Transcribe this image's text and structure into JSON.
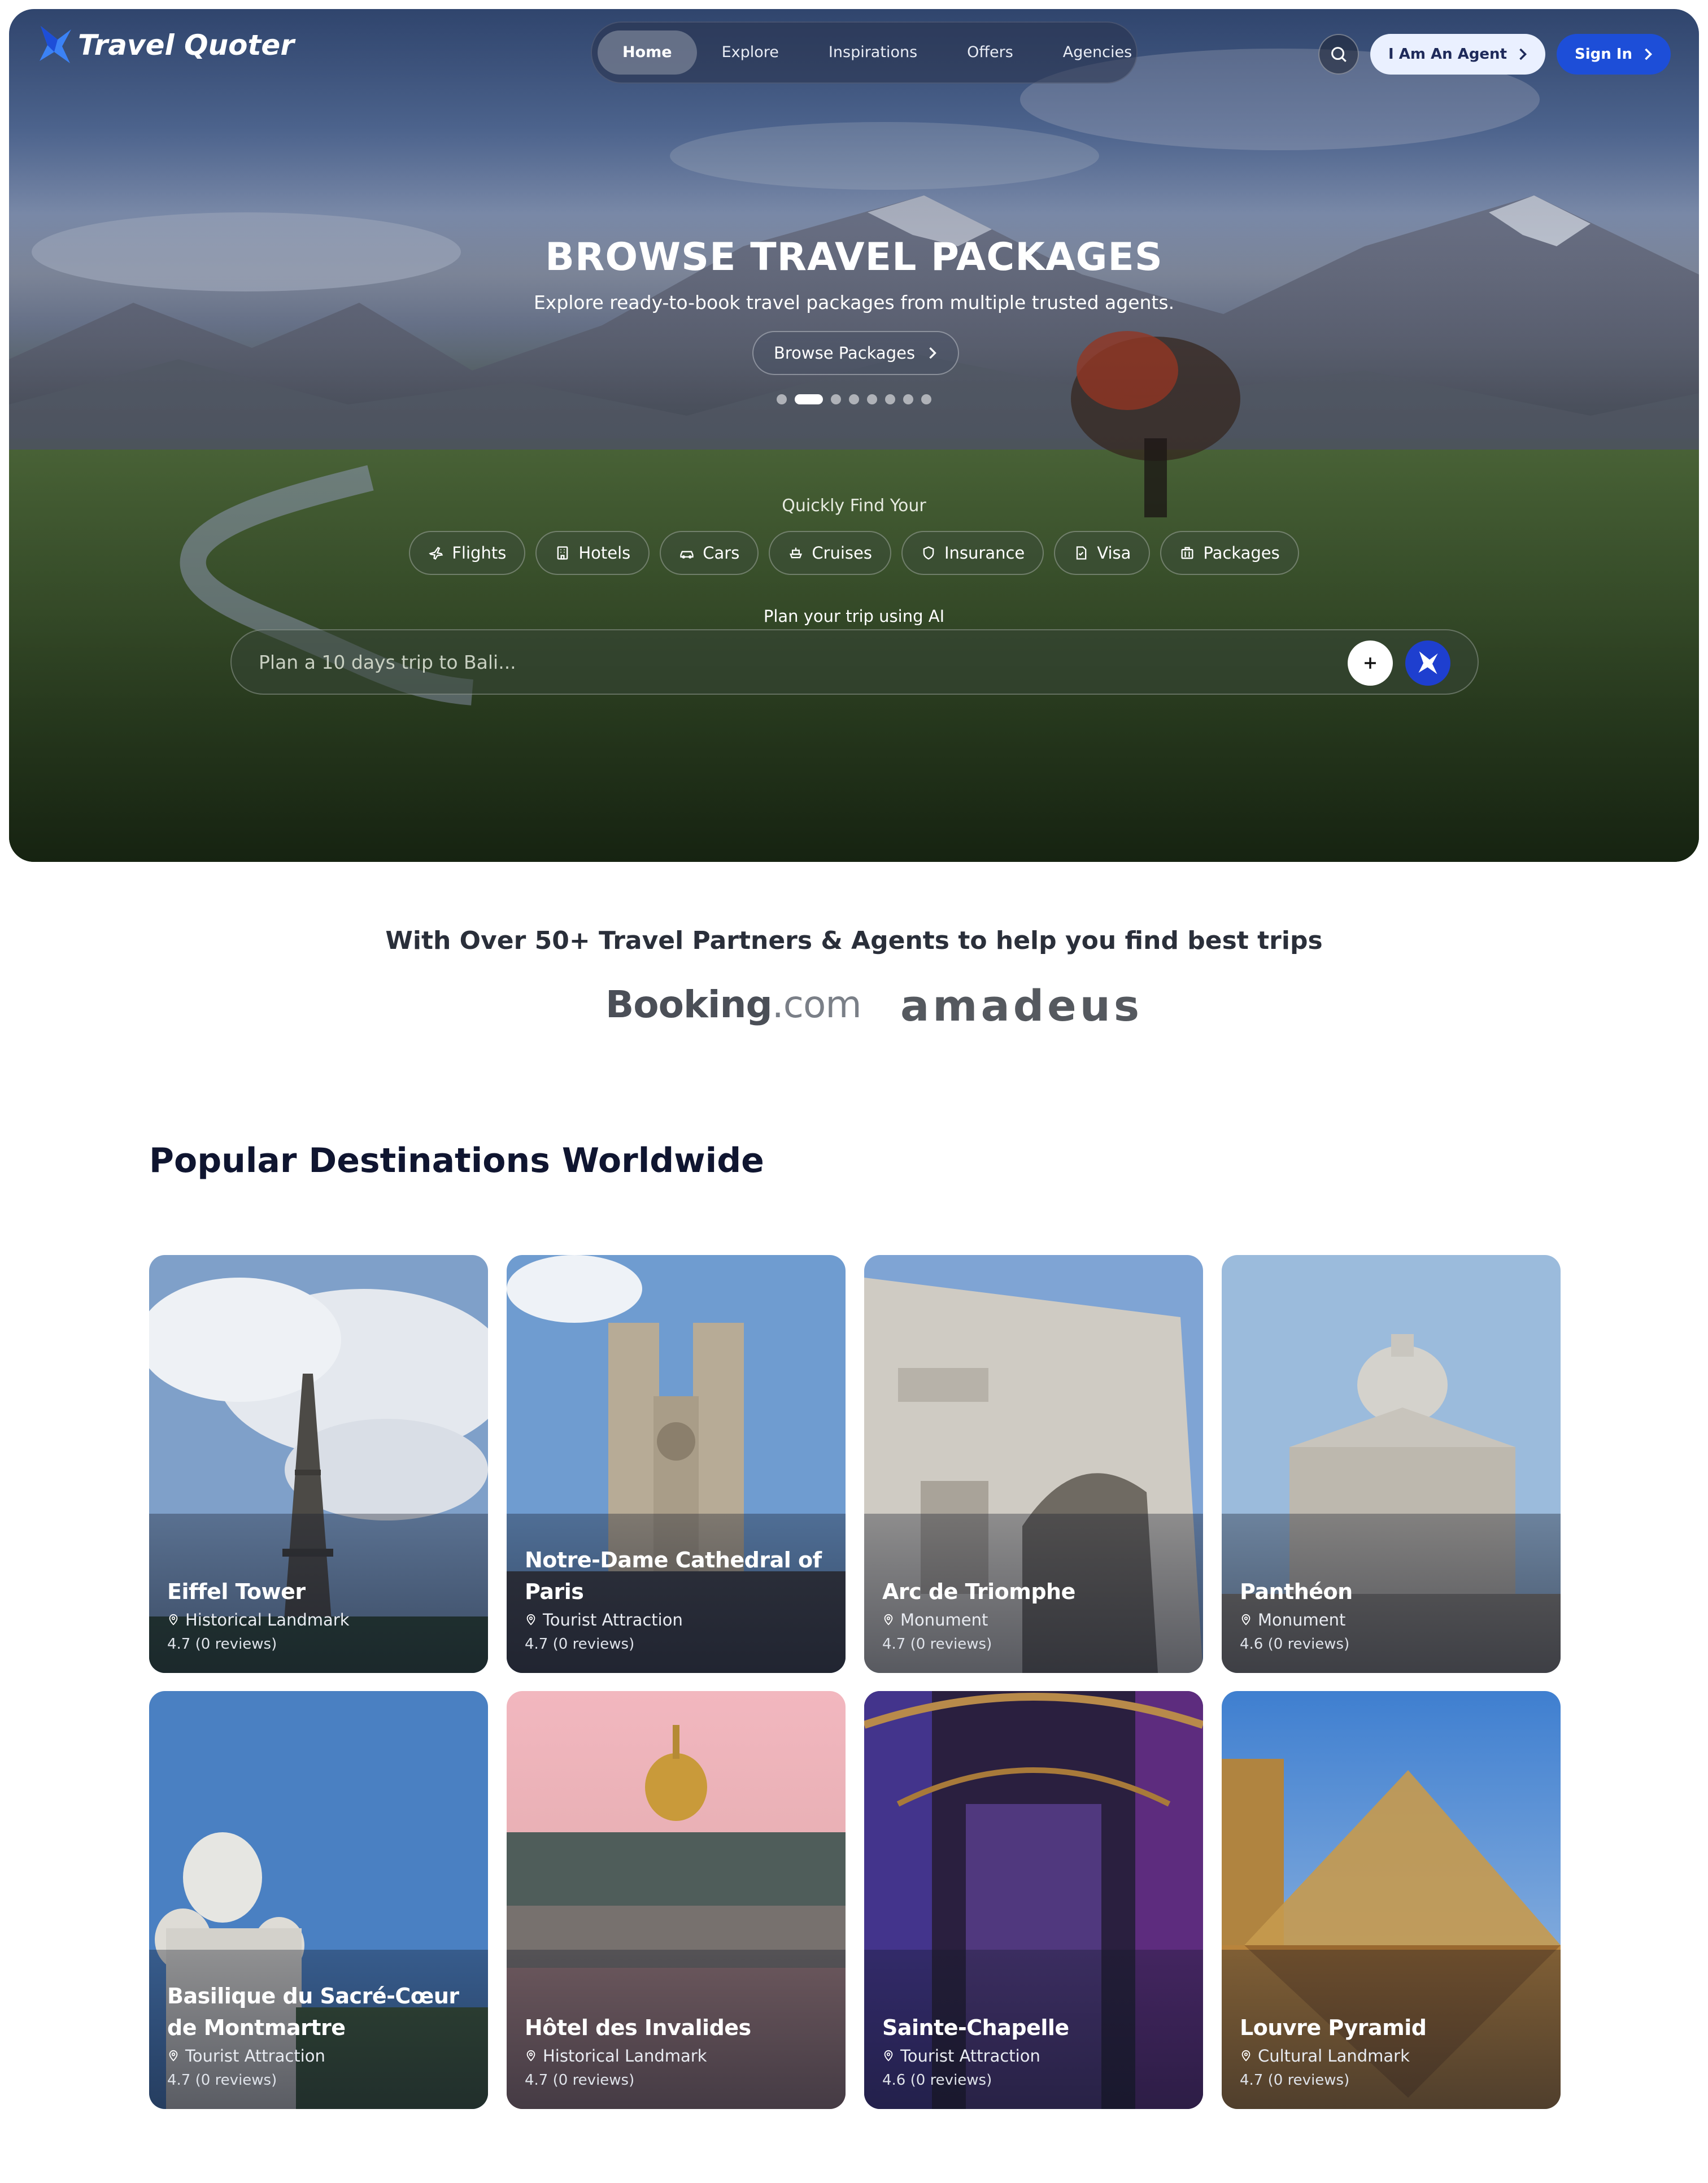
{
  "nav": {
    "brand": "Travel Quoter",
    "items": [
      {
        "label": "Home",
        "active": true
      },
      {
        "label": "Explore",
        "active": false
      },
      {
        "label": "Inspirations",
        "active": false
      },
      {
        "label": "Offers",
        "active": false
      },
      {
        "label": "Agencies",
        "active": false
      }
    ],
    "search_icon": "search-icon",
    "agent_label": "I Am An Agent",
    "signin_label": "Sign In"
  },
  "hero": {
    "title": "BROWSE TRAVEL PACKAGES",
    "subtitle": "Explore ready-to-book travel packages from multiple trusted agents.",
    "cta_label": "Browse Packages",
    "slides": 8,
    "active_slide": 2,
    "quick_label": "Quickly Find Your",
    "chips": [
      {
        "label": "Flights",
        "icon": "plane-icon"
      },
      {
        "label": "Hotels",
        "icon": "building-icon"
      },
      {
        "label": "Cars",
        "icon": "car-icon"
      },
      {
        "label": "Cruises",
        "icon": "ship-icon"
      },
      {
        "label": "Insurance",
        "icon": "shield-icon"
      },
      {
        "label": "Visa",
        "icon": "document-icon"
      },
      {
        "label": "Packages",
        "icon": "luggage-icon"
      }
    ],
    "ai_label": "Plan your trip using AI",
    "ai_placeholder": "Plan a 10 days trip to Bali..."
  },
  "partners": {
    "title": "With Over 50+ Travel Partners & Agents to help you find best trips",
    "logos": [
      {
        "name": "Booking",
        "suffix": ".com"
      },
      {
        "name": "amadeus"
      }
    ]
  },
  "destinations": {
    "title": "Popular Destinations Worldwide",
    "cards": [
      {
        "name": "Eiffel Tower",
        "category": "Historical Landmark",
        "rating": "4.7 (0 reviews)"
      },
      {
        "name": "Notre-Dame Cathedral of Paris",
        "category": "Tourist Attraction",
        "rating": "4.7 (0 reviews)"
      },
      {
        "name": "Arc de Triomphe",
        "category": "Monument",
        "rating": "4.7 (0 reviews)"
      },
      {
        "name": "Panthéon",
        "category": "Monument",
        "rating": "4.6 (0 reviews)"
      },
      {
        "name": "Basilique du Sacré-Cœur de Montmartre",
        "category": "Tourist Attraction",
        "rating": "4.7 (0 reviews)"
      },
      {
        "name": "Hôtel des Invalides",
        "category": "Historical Landmark",
        "rating": "4.7 (0 reviews)"
      },
      {
        "name": "Sainte-Chapelle",
        "category": "Tourist Attraction",
        "rating": "4.6 (0 reviews)"
      },
      {
        "name": "Louvre Pyramid",
        "category": "Cultural Landmark",
        "rating": "4.7 (0 reviews)"
      }
    ]
  },
  "colors": {
    "primary": "#1d4ed8",
    "ai_button": "#1e3fcf",
    "heading": "#0f1530"
  }
}
